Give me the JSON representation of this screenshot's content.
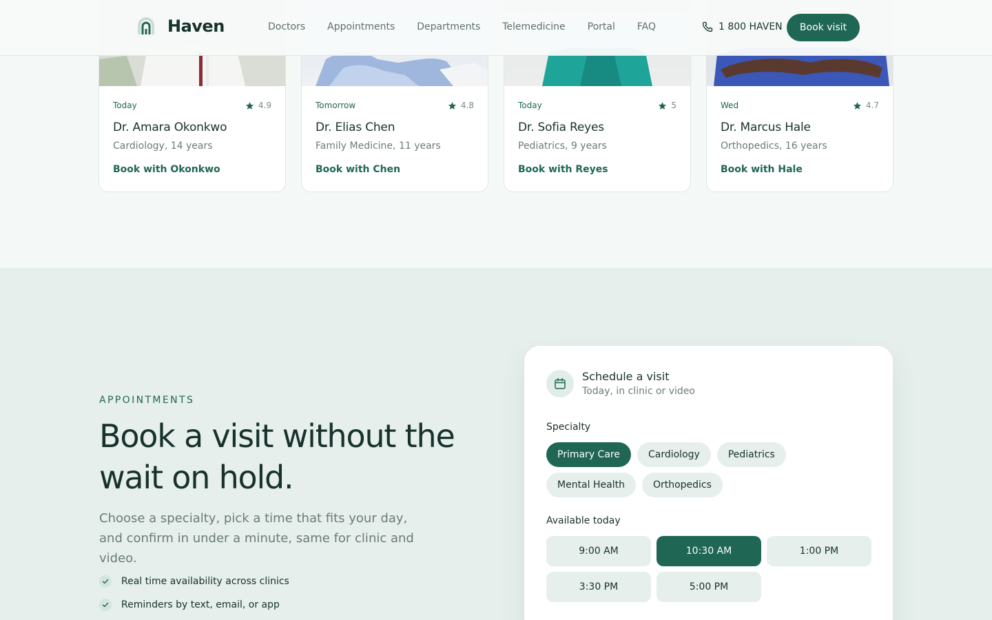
{
  "brand": {
    "name": "Haven"
  },
  "nav": [
    {
      "label": "Doctors"
    },
    {
      "label": "Appointments"
    },
    {
      "label": "Departments"
    },
    {
      "label": "Telemedicine"
    },
    {
      "label": "Portal"
    },
    {
      "label": "FAQ"
    }
  ],
  "header": {
    "phone": "1 800 HAVEN",
    "cta": "Book visit"
  },
  "doctors": [
    {
      "availability": "Today",
      "rating": "4.9",
      "name": "Dr. Amara Okonkwo",
      "specialty": "Cardiology, 14 years",
      "book": "Book with Okonkwo"
    },
    {
      "availability": "Tomorrow",
      "rating": "4.8",
      "name": "Dr. Elias Chen",
      "specialty": "Family Medicine, 11 years",
      "book": "Book with Chen"
    },
    {
      "availability": "Today",
      "rating": "5",
      "name": "Dr. Sofia Reyes",
      "specialty": "Pediatrics, 9 years",
      "book": "Book with Reyes"
    },
    {
      "availability": "Wed",
      "rating": "4.7",
      "name": "Dr. Marcus Hale",
      "specialty": "Orthopedics, 16 years",
      "book": "Book with Hale"
    }
  ],
  "appointments": {
    "eyebrow": "APPOINTMENTS",
    "headline": "Book a visit without the wait on hold.",
    "lead": "Choose a specialty, pick a time that fits your day, and confirm in under a minute, same for clinic and video.",
    "bullets": [
      "Real time availability across clinics",
      "Reminders by text, email, or app"
    ]
  },
  "scheduler": {
    "title": "Schedule a visit",
    "subtitle": "Today, in clinic or video",
    "specialty_label": "Specialty",
    "specialties": [
      "Primary Care",
      "Cardiology",
      "Pediatrics",
      "Mental Health",
      "Orthopedics"
    ],
    "selected_specialty": "Primary Care",
    "time_label": "Available today",
    "times": [
      "9:00 AM",
      "10:30 AM",
      "1:00 PM",
      "3:30 PM",
      "5:00 PM"
    ],
    "selected_time": "10:30 AM"
  },
  "colors": {
    "brand": "#1f6655",
    "ink": "#17312b",
    "muted": "#6b7b78",
    "section_bg": "#e6efec",
    "page_bg": "#f4f8f7"
  }
}
